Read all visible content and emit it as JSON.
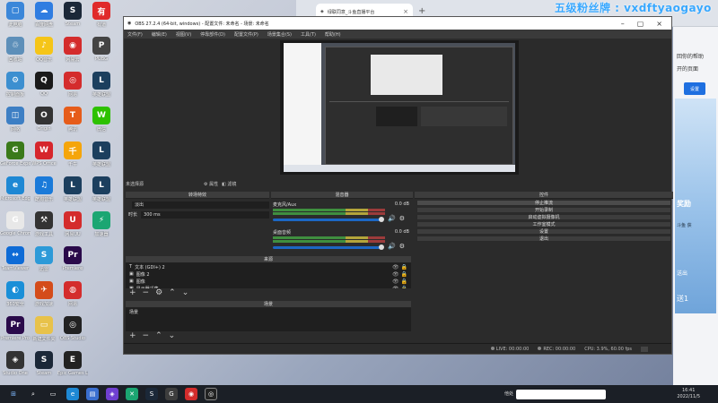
{
  "watermark": "五级粉丝牌 : vxdftyaogayo",
  "browser": {
    "tab_title": "绿联同意_斗鱼直播平台",
    "sidebar_text1": "回你的帮助",
    "sidebar_text2": "开的页面",
    "sidebar_button": "设置",
    "side_labels": [
      "奖励",
      "斗鱼 获",
      "送出",
      "送1"
    ]
  },
  "desktop_icons": [
    {
      "label": "此电脑",
      "color": "#3b87d9",
      "glyph": "▢"
    },
    {
      "label": "百度网盘",
      "color": "#2f7de1",
      "glyph": "☁"
    },
    {
      "label": "Steam",
      "color": "#1b2838",
      "glyph": "S"
    },
    {
      "label": "有道",
      "color": "#e02a2a",
      "glyph": "有"
    },
    {
      "label": "回收站",
      "color": "#5d8fb9",
      "glyph": "♲"
    },
    {
      "label": "QQ音乐",
      "color": "#f5c518",
      "glyph": "♪"
    },
    {
      "label": "网易云",
      "color": "#d42c2c",
      "glyph": "◉"
    },
    {
      "label": "PUBG",
      "color": "#444",
      "glyph": "P"
    },
    {
      "label": "控制面板",
      "color": "#3c8fd0",
      "glyph": "⚙"
    },
    {
      "label": "QQ",
      "color": "#1a1a1a",
      "glyph": "Q"
    },
    {
      "label": "网易",
      "color": "#d42c2c",
      "glyph": "◎"
    },
    {
      "label": "英雄联盟",
      "color": "#1c3f5e",
      "glyph": "L"
    },
    {
      "label": "网络",
      "color": "#3d7fc4",
      "glyph": "◫"
    },
    {
      "label": "Origin",
      "color": "#333",
      "glyph": "O"
    },
    {
      "label": "腾讯",
      "color": "#e65c1a",
      "glyph": "T"
    },
    {
      "label": "微信",
      "color": "#2dc100",
      "glyph": "W"
    },
    {
      "label": "GeForce Experience",
      "color": "#3a7a1a",
      "glyph": "G"
    },
    {
      "label": "WPS Office",
      "color": "#d6262c",
      "glyph": "W"
    },
    {
      "label": "千牛",
      "color": "#f5a50a",
      "glyph": "千"
    },
    {
      "label": "英雄联盟",
      "color": "#1c3f5e",
      "glyph": "L"
    },
    {
      "label": "Microsoft Edge",
      "color": "#1e88d4",
      "glyph": "e"
    },
    {
      "label": "酷狗音乐",
      "color": "#1a7ad9",
      "glyph": "♫"
    },
    {
      "label": "英雄联盟",
      "color": "#1c3f5e",
      "glyph": "L"
    },
    {
      "label": "英雄联盟",
      "color": "#1c3f5e",
      "glyph": "L"
    },
    {
      "label": "Google Chrome",
      "color": "#e8e8e8",
      "glyph": "G"
    },
    {
      "label": "游戏工具",
      "color": "#333",
      "glyph": "⚒"
    },
    {
      "label": "网易UU",
      "color": "#d42c2c",
      "glyph": "U"
    },
    {
      "label": "加速器",
      "color": "#1ba672",
      "glyph": "⚡"
    },
    {
      "label": "TeamViewer",
      "color": "#0e6bd6",
      "glyph": "↔"
    },
    {
      "label": "迅雷",
      "color": "#2d9ad8",
      "glyph": "S"
    },
    {
      "label": "Premiere",
      "color": "#2a0a4a",
      "glyph": "Pr"
    },
    {
      "label": "",
      "color": "transparent",
      "glyph": ""
    },
    {
      "label": "360安全",
      "color": "#1a8fd8",
      "glyph": "◐"
    },
    {
      "label": "游戏加速",
      "color": "#d44c1a",
      "glyph": "✈"
    },
    {
      "label": "网易",
      "color": "#d42c2c",
      "glyph": "◍"
    },
    {
      "label": "",
      "color": "transparent",
      "glyph": ""
    },
    {
      "label": "Premiere Pro",
      "color": "#2a0a4a",
      "glyph": "Pr"
    },
    {
      "label": "新建文件夹",
      "color": "#e8c24a",
      "glyph": "▭"
    },
    {
      "label": "OBS Studio",
      "color": "#222",
      "glyph": "◎"
    },
    {
      "label": "",
      "color": "transparent",
      "glyph": ""
    },
    {
      "label": "Studio One",
      "color": "#333",
      "glyph": "◈"
    },
    {
      "label": "Steam",
      "color": "#1b2838",
      "glyph": "S"
    },
    {
      "label": "Epic Games Launcher",
      "color": "#222",
      "glyph": "E"
    },
    {
      "label": "",
      "color": "transparent",
      "glyph": ""
    }
  ],
  "obs": {
    "title": "OBS 27.2.4 (64-bit, windows) - 配置文件: 未命名 - 场景: 未命名",
    "menu": [
      "文件(F)",
      "编辑(E)",
      "视图(V)",
      "停靠部件(D)",
      "配置文件(P)",
      "场景集合(S)",
      "工具(T)",
      "帮助(H)"
    ],
    "no_source": "未选择源",
    "props": "属性",
    "filters_btn": "滤镜",
    "transitions_title": "转场特效",
    "transition_type": "淡出",
    "duration_label": "时长",
    "duration_value": "300 ms",
    "mixer_title": "混音器",
    "track1_name": "麦克风/Aux",
    "track1_db": "0.0 dB",
    "track2_name": "桌面音频",
    "track2_db": "0.0 dB",
    "controls_title": "控件",
    "controls": [
      "停止推流",
      "开始录制",
      "启动虚拟摄像机",
      "工作室模式",
      "设置",
      "退出"
    ],
    "sources_title": "来源",
    "sources": [
      {
        "icon": "T",
        "name": "文本 (GDI+) 2"
      },
      {
        "icon": "▣",
        "name": "图像 2"
      },
      {
        "icon": "▣",
        "name": "图像"
      },
      {
        "icon": "▣",
        "name": "显示器采集"
      }
    ],
    "scenes_title": "场景",
    "scene_name": "场景",
    "status_live": "LIVE: 00:00:00",
    "status_rec": "REC: 00:00:00",
    "status_cpu": "CPU: 3.9%, 60.00 fps"
  },
  "taskbar": {
    "tray_label": "他处",
    "time": "16:41",
    "date": "2022/11/5"
  }
}
